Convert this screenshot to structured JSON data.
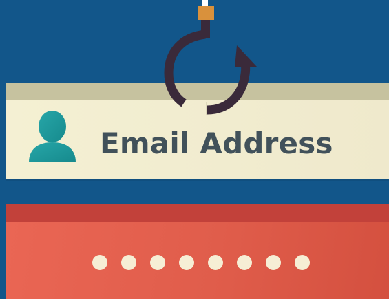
{
  "email_field": {
    "label": "Email Address",
    "icon": "user-icon"
  },
  "password_field": {
    "masked_length": 8,
    "mask_char": "•"
  },
  "hook": {
    "icon": "refresh-hook-icon"
  },
  "colors": {
    "background": "#12568a",
    "email_bg": "#f4f0d3",
    "email_strip": "#c6c29f",
    "email_text": "#41515a",
    "user_icon": "#1f9a9c",
    "password_bg": "#e56150",
    "password_strip": "#c2413a",
    "dots": "#f6eed5",
    "hook_dark": "#3a2a3a",
    "hook_tag": "#d9913c"
  }
}
